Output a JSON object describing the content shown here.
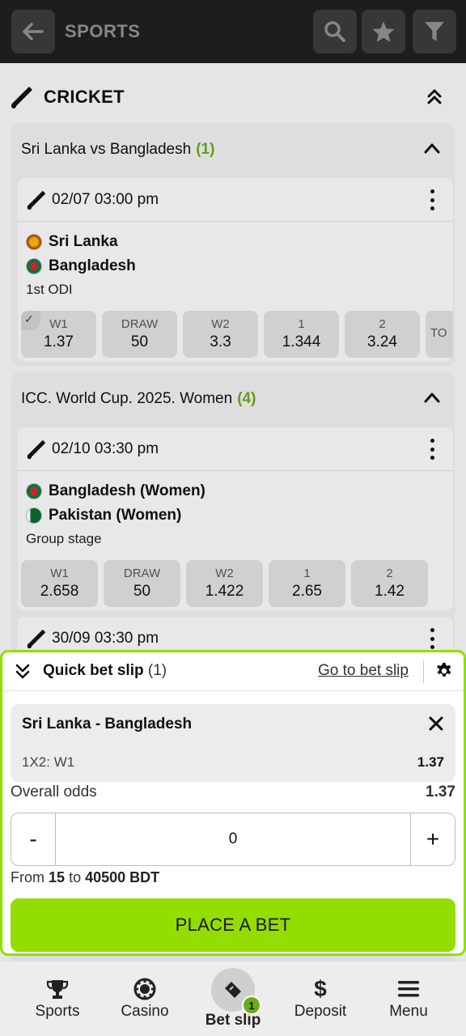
{
  "header": {
    "title": "SPORTS"
  },
  "sport": {
    "title": "CRICKET"
  },
  "leagues": [
    {
      "name": "Sri Lanka vs Bangladesh",
      "count": "(1)",
      "match": {
        "datetime": "02/07 03:00 pm",
        "team1": "Sri Lanka",
        "team2": "Bangladesh",
        "stage": "1st ODI",
        "odds": [
          {
            "label": "W1",
            "value": "1.37",
            "selected": true
          },
          {
            "label": "DRAW",
            "value": "50"
          },
          {
            "label": "W2",
            "value": "3.3"
          },
          {
            "label": "1",
            "value": "1.344"
          },
          {
            "label": "2",
            "value": "3.24"
          },
          {
            "label": "TO",
            "value": ""
          }
        ]
      }
    },
    {
      "name": "ICC. World Cup. 2025. Women",
      "count": "(4)",
      "match": {
        "datetime": "02/10 03:30 pm",
        "team1": "Bangladesh (Women)",
        "team2": "Pakistan (Women)",
        "stage": "Group stage",
        "odds": [
          {
            "label": "W1",
            "value": "2.658"
          },
          {
            "label": "DRAW",
            "value": "50"
          },
          {
            "label": "W2",
            "value": "1.422"
          },
          {
            "label": "1",
            "value": "2.65"
          },
          {
            "label": "2",
            "value": "1.42"
          }
        ]
      },
      "next_match": {
        "datetime": "30/09 03:30 pm"
      }
    }
  ],
  "quick_slip": {
    "title": "Quick bet slip",
    "count": "(1)",
    "link": "Go to bet slip",
    "bet": {
      "match": "Sri Lanka - Bangladesh",
      "market": "1X2: W1",
      "odd": "1.37"
    },
    "overall_label": "Overall odds",
    "overall_value": "1.37",
    "minus": "-",
    "plus": "+",
    "amount": "0",
    "range_from_label": "From",
    "range_min": "15",
    "range_to_label": "to",
    "range_max": "40500 BDT",
    "place_label": "PLACE A BET"
  },
  "nav": {
    "sports": "Sports",
    "casino": "Casino",
    "betslip": "Bet slip",
    "betslip_badge": "1",
    "deposit": "Deposit",
    "deposit_icon": "$",
    "menu": "Menu"
  },
  "colors": {
    "accent": "#93dd02",
    "green_text": "#6aa51e",
    "topbar": "#1f1f1f"
  }
}
